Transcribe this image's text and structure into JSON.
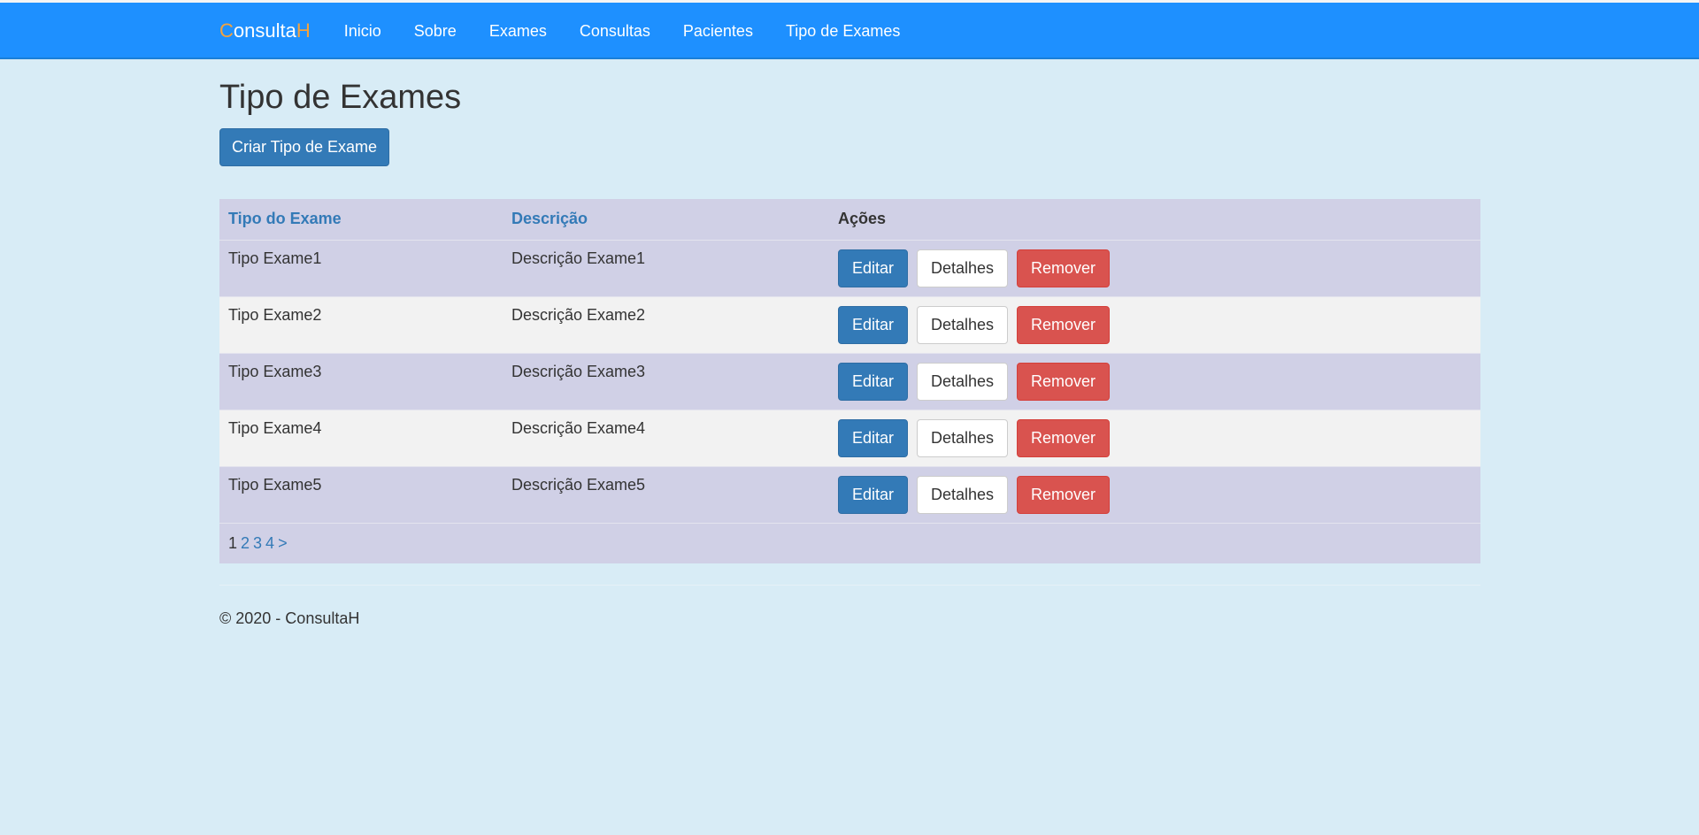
{
  "navbar": {
    "brand_first": "C",
    "brand_middle": "onsulta",
    "brand_last": "H",
    "links": [
      "Inicio",
      "Sobre",
      "Exames",
      "Consultas",
      "Pacientes",
      "Tipo de Exames"
    ]
  },
  "page": {
    "title": "Tipo de Exames",
    "create_button": "Criar Tipo de Exame"
  },
  "table": {
    "headers": [
      "Tipo do Exame",
      "Descrição",
      "Ações"
    ],
    "rows": [
      {
        "tipo": "Tipo Exame1",
        "descricao": "Descrição Exame1"
      },
      {
        "tipo": "Tipo Exame2",
        "descricao": "Descrição Exame2"
      },
      {
        "tipo": "Tipo Exame3",
        "descricao": "Descrição Exame3"
      },
      {
        "tipo": "Tipo Exame4",
        "descricao": "Descrição Exame4"
      },
      {
        "tipo": "Tipo Exame5",
        "descricao": "Descrição Exame5"
      }
    ],
    "actions": {
      "edit": "Editar",
      "details": "Detalhes",
      "remove": "Remover"
    }
  },
  "pagination": {
    "current": "1",
    "pages": [
      "2",
      "3",
      "4"
    ],
    "next": ">"
  },
  "footer": {
    "text": "© 2020 - ConsultaH"
  },
  "colors": {
    "navbar": "#1e90ff",
    "page_background": "#d8ecf6",
    "brand_accent": "#f5a23c",
    "primary": "#337ab7",
    "danger": "#d9534f"
  }
}
